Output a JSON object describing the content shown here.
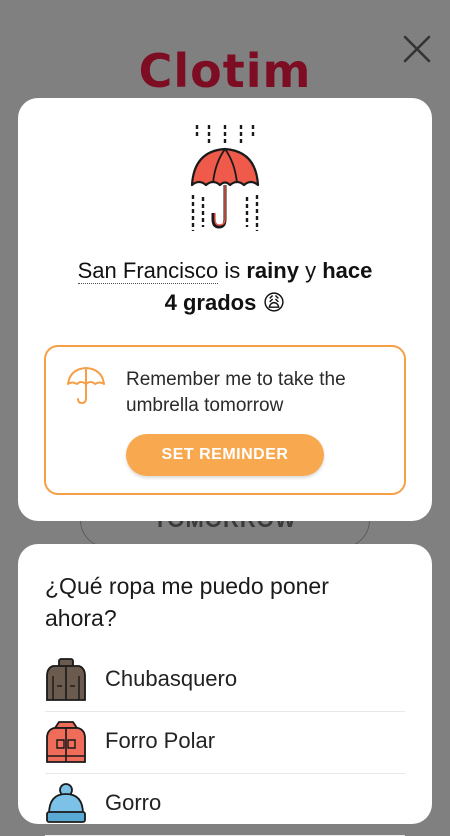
{
  "app": {
    "logo": "Clotim"
  },
  "background": {
    "tomorrow_button": "TOMORROW"
  },
  "weather": {
    "city": "San Francisco",
    "is": " is ",
    "condition": "rainy",
    "conj": " y ",
    "hace": "hace",
    "temp_text": "4 grados",
    "emoji": "😩",
    "icon": "rain-umbrella-icon",
    "accent": "#ef5a4a"
  },
  "reminder": {
    "text": "Remember me to take the umbrella tomorrow",
    "button": "SET REMINDER",
    "icon": "umbrella-icon",
    "accent": "#f5a047"
  },
  "clothes": {
    "question": "¿Qué ropa me puedo poner ahora?",
    "items": [
      {
        "label": "Chubasquero",
        "icon": "raincoat-icon"
      },
      {
        "label": "Forro Polar",
        "icon": "fleece-jacket-icon"
      },
      {
        "label": "Gorro",
        "icon": "beanie-icon"
      }
    ]
  }
}
